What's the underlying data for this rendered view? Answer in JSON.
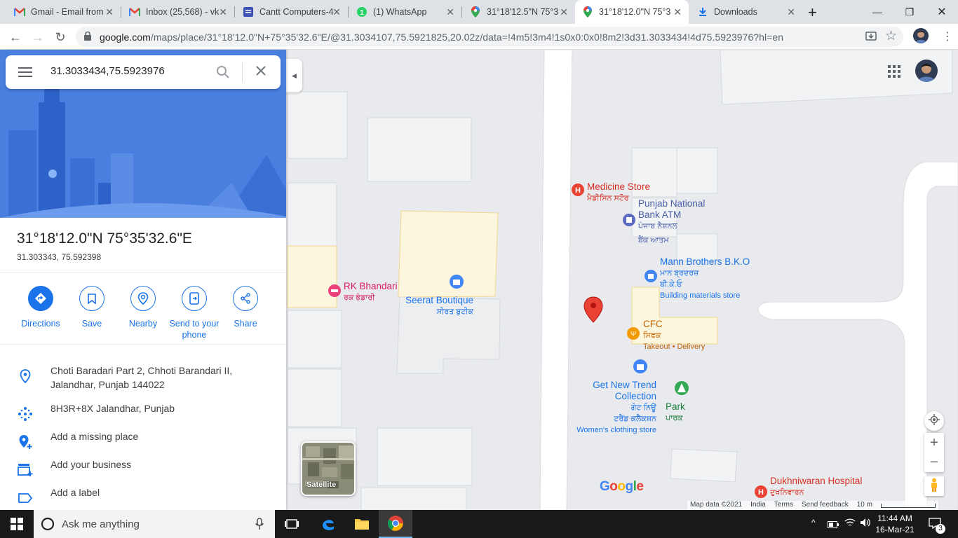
{
  "browser": {
    "tabs": [
      {
        "title": "Gmail - Email from",
        "icon": "gmail-icon"
      },
      {
        "title": "Inbox (25,568) - vk",
        "icon": "gmail-icon"
      },
      {
        "title": "Cantt Computers-4",
        "icon": "docs-icon"
      },
      {
        "title": "(1) WhatsApp",
        "icon": "whatsapp-icon"
      },
      {
        "title": "31°18'12.5\"N 75°3",
        "icon": "maps-icon"
      },
      {
        "title": "31°18'12.0\"N 75°3",
        "icon": "maps-icon"
      },
      {
        "title": "Downloads",
        "icon": "download-icon"
      }
    ],
    "url_host": "google.com",
    "url_path": "/maps/place/31°18'12.0\"N+75°35'32.6\"E/@31.3034107,75.5921825,20.02z/data=!4m5!3m4!1s0x0:0x0!8m2!3d31.3033434!4d75.5923976?hl=en"
  },
  "panel": {
    "search_value": "31.3033434,75.5923976",
    "place_title": "31°18'12.0\"N 75°35'32.6\"E",
    "place_coords": "31.303343, 75.592398",
    "actions": [
      {
        "label": "Directions"
      },
      {
        "label": "Save"
      },
      {
        "label": "Nearby"
      },
      {
        "label": "Send to your phone"
      },
      {
        "label": "Share"
      }
    ],
    "info": [
      {
        "text": "Choti Baradari Part 2, Chhoti Barandari II, Jalandhar, Punjab 144022"
      },
      {
        "text": "8H3R+8X Jalandhar, Punjab"
      },
      {
        "text": "Add a missing place"
      },
      {
        "text": "Add your business"
      },
      {
        "text": "Add a label"
      }
    ]
  },
  "map": {
    "pois": [
      {
        "name": "Medicine Store",
        "local": "ਮੈਡੀਸਿਨ ਸਟੋਰ",
        "color": "#d93025"
      },
      {
        "name": "Punjab National Bank ATM",
        "local1": "ਪੰਜਾਬ ਨੈਸ਼ਨਲ",
        "local2": "ਬੈਂਕ ਆਤਮ",
        "color": "#4a5fa8"
      },
      {
        "name": "Mann Brothers B.K.O",
        "local1": "ਮਾਨ ਬ੍ਰਦਰਜ਼",
        "local2": "ਬੀ.ਕੇ.ਓ",
        "category": "Building materials store",
        "color": "#1a73e8"
      },
      {
        "name": "RK Bhandari",
        "local": "ਰਕ ਭੰਡਾਰੀ",
        "color": "#d81b60"
      },
      {
        "name": "Seerat Boutique",
        "local": "ਸੀਰਤ ਬੁਟੀਕ",
        "color": "#1a73e8"
      },
      {
        "name": "CFC",
        "local": "ਸਿਫਕ",
        "category": "Takeout • Delivery",
        "color": "#c26400"
      },
      {
        "name": "Get New Trend Collection",
        "local1": "ਗੇਟ ਨਿਊ",
        "local2": "ਟਰੈਂਡ ਕਲੈਕਸ਼ਨ",
        "category": "Women's clothing store",
        "color": "#1a73e8"
      },
      {
        "name": "Park",
        "local": "ਪਾਰਕ",
        "color": "#188038"
      },
      {
        "name": "Dukhniwaran Hospital",
        "local": "ਦੁਖਨਿਵਾਰਨ",
        "color": "#d93025"
      }
    ],
    "satellite_label": "Satellite",
    "logo_text": "Google",
    "attribution": [
      "Map data ©2021",
      "India",
      "Terms",
      "Send feedback",
      "10 m"
    ]
  },
  "taskbar": {
    "search_placeholder": "Ask me anything",
    "time": "11:44 AM",
    "date": "16-Mar-21",
    "notifications": "3"
  }
}
